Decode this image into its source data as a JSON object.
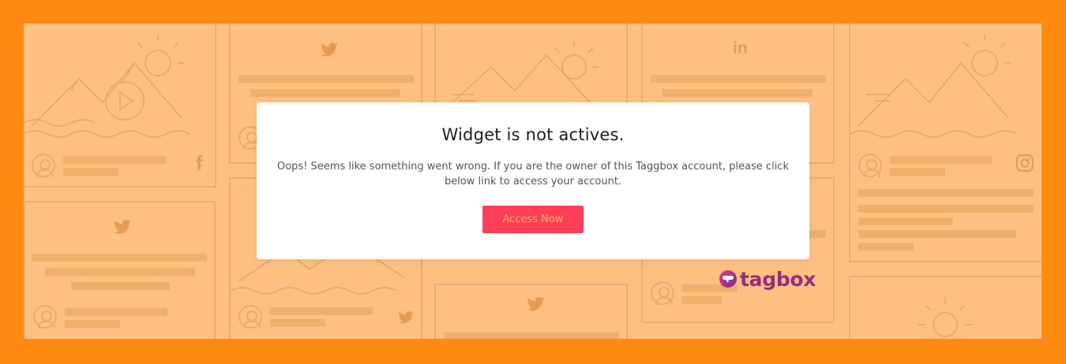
{
  "modal": {
    "title": "Widget is not actives.",
    "message": "Oops! Seems like something went wrong. If you are the owner of this Taggbox account, please click below link to access your account.",
    "button_label": "Access Now"
  },
  "brand": {
    "name": "tagbox"
  },
  "background_icons": [
    "facebook-icon",
    "twitter-icon",
    "linkedin-icon",
    "instagram-icon",
    "play-icon",
    "sun-icon"
  ],
  "colors": {
    "frame": "#ff8a12",
    "backdrop": "#ffc183",
    "button": "#ff3f57",
    "button_text": "#ffb55f",
    "brand": "#9a2a82"
  }
}
